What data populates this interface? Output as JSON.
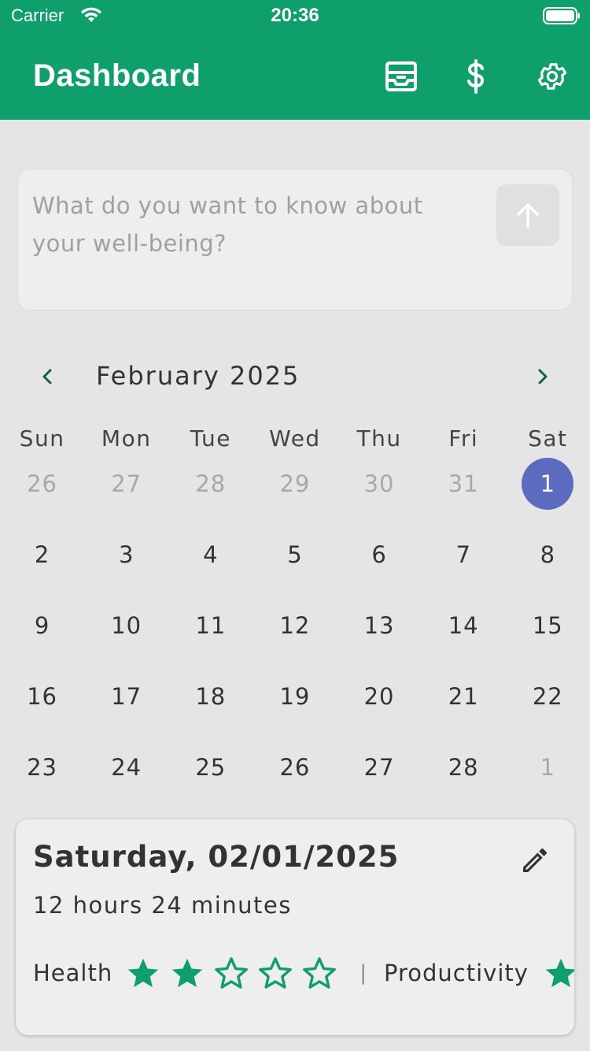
{
  "status_bar": {
    "carrier": "Carrier",
    "time": "20:36"
  },
  "header": {
    "title": "Dashboard",
    "icons": [
      "inbox-icon",
      "dollar-icon",
      "gear-icon"
    ],
    "bg_color": "#0e9f6b"
  },
  "ask": {
    "placeholder": "What do you want to know about your well-being?"
  },
  "calendar": {
    "month_label": "February 2025",
    "weekdays": [
      "Sun",
      "Mon",
      "Tue",
      "Wed",
      "Thu",
      "Fri",
      "Sat"
    ],
    "weeks": [
      [
        "26",
        "27",
        "28",
        "29",
        "30",
        "31",
        "1"
      ],
      [
        "2",
        "3",
        "4",
        "5",
        "6",
        "7",
        "8"
      ],
      [
        "9",
        "10",
        "11",
        "12",
        "13",
        "14",
        "15"
      ],
      [
        "16",
        "17",
        "18",
        "19",
        "20",
        "21",
        "22"
      ],
      [
        "23",
        "24",
        "25",
        "26",
        "27",
        "28",
        "1"
      ]
    ],
    "selected_color": "#5c6bc0"
  },
  "day_card": {
    "date": "Saturday, 02/01/2025",
    "duration": "12 hours 24 minutes",
    "ratings": [
      {
        "label": "Health",
        "stars": 2,
        "max": 5
      },
      {
        "label": "Productivity"
      }
    ],
    "separator": "|",
    "star_color": "#0e9f6b"
  }
}
